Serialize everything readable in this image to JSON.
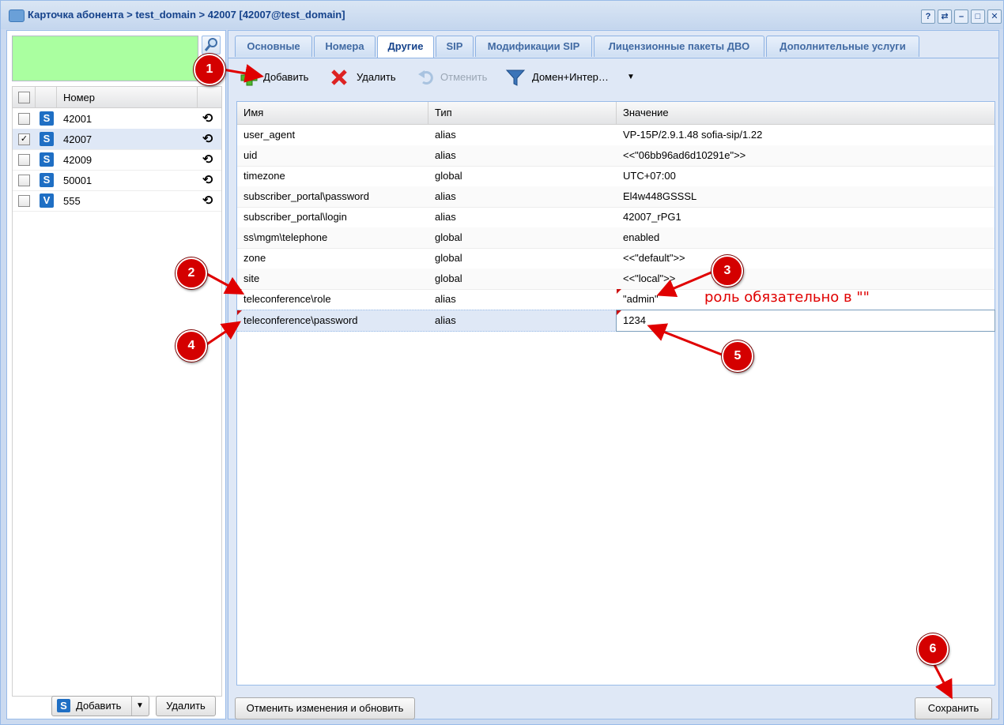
{
  "window": {
    "title": "Карточка абонента > test_domain > 42007 [42007@test_domain]",
    "tools": [
      "?",
      "⇄",
      "–",
      "□",
      "✕"
    ]
  },
  "left_panel": {
    "column_header": "Номер",
    "rows": [
      {
        "type": "S",
        "number": "42001",
        "checked": false
      },
      {
        "type": "S",
        "number": "42007",
        "checked": true
      },
      {
        "type": "S",
        "number": "42009",
        "checked": false
      },
      {
        "type": "S",
        "number": "50001",
        "checked": false
      },
      {
        "type": "V",
        "number": "555",
        "checked": false
      }
    ],
    "add_label": "Добавить",
    "delete_label": "Удалить"
  },
  "tabs": [
    "Основные",
    "Номера",
    "Другие",
    "SIP",
    "Модификации SIP",
    "Лицензионные пакеты ДВО",
    "Дополнительные услуги"
  ],
  "active_tab": "Другие",
  "toolbar": {
    "add": "Добавить",
    "delete": "Удалить",
    "cancel": "Отменить",
    "filter": "Домен+Интер…"
  },
  "grid": {
    "columns": [
      "Имя",
      "Тип",
      "Значение"
    ],
    "rows": [
      {
        "name": "user_agent",
        "type": "alias",
        "value": "VP-15P/2.9.1.48 sofia-sip/1.22"
      },
      {
        "name": "uid",
        "type": "alias",
        "value": "<<\"06bb96ad6d10291e\">>"
      },
      {
        "name": "timezone",
        "type": "global",
        "value": "UTC+07:00"
      },
      {
        "name": "subscriber_portal\\password",
        "type": "alias",
        "value": "El4w448GSSSL"
      },
      {
        "name": "subscriber_portal\\login",
        "type": "alias",
        "value": "42007_rPG1"
      },
      {
        "name": "ss\\mgm\\telephone",
        "type": "global",
        "value": "enabled"
      },
      {
        "name": "zone",
        "type": "global",
        "value": "<<\"default\">>"
      },
      {
        "name": "site",
        "type": "global",
        "value": "<<\"local\">>"
      },
      {
        "name": "teleconference\\role",
        "type": "alias",
        "value": "\"admin\""
      },
      {
        "name": "teleconference\\password",
        "type": "alias",
        "value": "1234"
      }
    ]
  },
  "bottom": {
    "cancel_refresh": "Отменить изменения и обновить",
    "save": "Сохранить"
  },
  "annotations": {
    "markers": [
      "1",
      "2",
      "3",
      "4",
      "5",
      "6"
    ],
    "note": "роль обязательно в \"\""
  },
  "colors": {
    "annotation_red": "#d40000",
    "title_blue": "#15428b",
    "search_green": "#aaffa0"
  }
}
